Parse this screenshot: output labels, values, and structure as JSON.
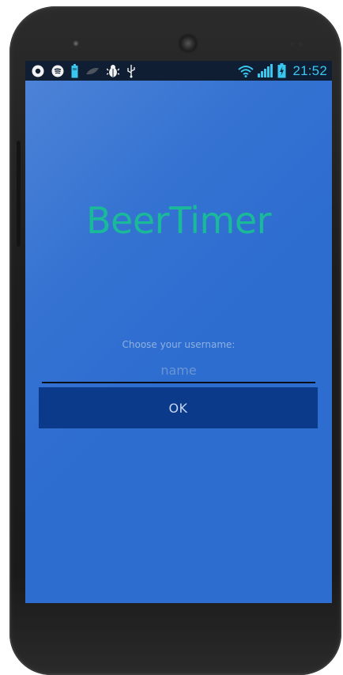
{
  "status_bar": {
    "left_icons": [
      "circle-app-icon",
      "spotify-icon",
      "battery-small-icon",
      "leaf-icon",
      "android-bug-icon",
      "usb-icon"
    ],
    "right_icons": [
      "wifi-icon",
      "signal-icon",
      "battery-charging-icon"
    ],
    "time": "21:52",
    "accent_color": "#39c7f0"
  },
  "app": {
    "title": "BeerTimer",
    "username_prompt": "Choose your username:",
    "username_placeholder": "name",
    "username_value": "",
    "ok_label": "OK"
  },
  "colors": {
    "background": "#2d6dd0",
    "title": "#19b99a",
    "button": "#0c3a8a"
  }
}
